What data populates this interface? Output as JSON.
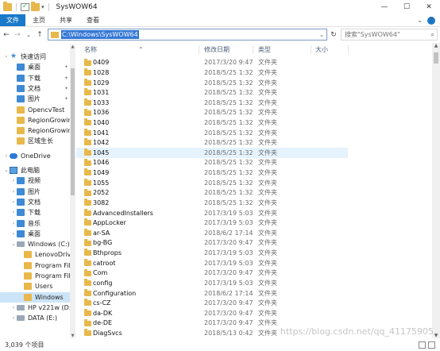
{
  "window": {
    "title": "SysWOW64",
    "minimize": "—",
    "maximize": "☐",
    "close": "✕"
  },
  "ribbon": {
    "tabs": [
      "文件",
      "主页",
      "共享",
      "查看"
    ],
    "expand": "⌄",
    "help": "?"
  },
  "nav": {
    "back": "←",
    "forward": "→",
    "recent": "⌄",
    "up": "↑",
    "address": "C:\\Windows\\SysWOW64",
    "refresh": "↻",
    "search_placeholder": "搜索\"SysWOW64\""
  },
  "columns": {
    "name": "名称",
    "date": "修改日期",
    "type": "类型",
    "size": "大小"
  },
  "sidebar": [
    {
      "label": "快速访问",
      "icon": "star-icon",
      "arrow": "›",
      "indent": 0,
      "pin": false
    },
    {
      "label": "桌面",
      "icon": "desktop-folder-icon",
      "indent": 1,
      "pin": true
    },
    {
      "label": "下载",
      "icon": "download-folder-icon",
      "indent": 1,
      "pin": true
    },
    {
      "label": "文档",
      "icon": "documents-folder-icon",
      "indent": 1,
      "pin": true
    },
    {
      "label": "图片",
      "icon": "pictures-folder-icon",
      "indent": 1,
      "pin": true
    },
    {
      "label": "OpencvTest",
      "icon": "folder-icon",
      "indent": 1,
      "pin": false
    },
    {
      "label": "RegionGrowing",
      "icon": "folder-icon",
      "indent": 1,
      "pin": false
    },
    {
      "label": "RegionGrowing",
      "icon": "folder-icon",
      "indent": 1,
      "pin": false
    },
    {
      "label": "区域生长",
      "icon": "folder-icon",
      "indent": 1,
      "pin": false
    },
    {
      "label": "OneDrive",
      "icon": "onedrive-icon",
      "arrow": "›",
      "indent": 0,
      "pin": false
    },
    {
      "label": "此电脑",
      "icon": "this-pc-icon",
      "arrow": "⌄",
      "indent": 0,
      "pin": false
    },
    {
      "label": "视频",
      "icon": "videos-folder-icon",
      "arrow": "›",
      "indent": 1,
      "pin": false
    },
    {
      "label": "图片",
      "icon": "pictures-folder-icon",
      "arrow": "›",
      "indent": 1,
      "pin": false
    },
    {
      "label": "文档",
      "icon": "documents-folder-icon",
      "arrow": "›",
      "indent": 1,
      "pin": false
    },
    {
      "label": "下载",
      "icon": "download-folder-icon",
      "arrow": "›",
      "indent": 1,
      "pin": false
    },
    {
      "label": "音乐",
      "icon": "music-folder-icon",
      "arrow": "›",
      "indent": 1,
      "pin": false
    },
    {
      "label": "桌面",
      "icon": "desktop-folder-icon",
      "arrow": "›",
      "indent": 1,
      "pin": false
    },
    {
      "label": "Windows (C:)",
      "icon": "drive-icon",
      "arrow": "⌄",
      "indent": 1,
      "pin": false
    },
    {
      "label": "LenovoDriver",
      "icon": "folder-icon",
      "indent": 2,
      "pin": false
    },
    {
      "label": "Program Files",
      "icon": "folder-icon",
      "indent": 2,
      "pin": false
    },
    {
      "label": "Program Files",
      "icon": "folder-icon",
      "indent": 2,
      "pin": false
    },
    {
      "label": "Users",
      "icon": "folder-icon",
      "indent": 2,
      "pin": false
    },
    {
      "label": "Windows",
      "icon": "folder-icon",
      "indent": 2,
      "pin": false,
      "selected": true
    },
    {
      "label": "HP v221w (D:)",
      "icon": "drive-icon",
      "arrow": "›",
      "indent": 1,
      "pin": false
    },
    {
      "label": "DATA (E:)",
      "icon": "drive-icon",
      "arrow": "›",
      "indent": 1,
      "pin": false
    }
  ],
  "files": [
    {
      "name": "0409",
      "date": "2017/3/20 9:47",
      "type": "文件夹"
    },
    {
      "name": "1028",
      "date": "2018/5/25 1:32",
      "type": "文件夹"
    },
    {
      "name": "1029",
      "date": "2018/5/25 1:32",
      "type": "文件夹"
    },
    {
      "name": "1031",
      "date": "2018/5/25 1:32",
      "type": "文件夹"
    },
    {
      "name": "1033",
      "date": "2018/5/25 1:32",
      "type": "文件夹"
    },
    {
      "name": "1036",
      "date": "2018/5/25 1:32",
      "type": "文件夹"
    },
    {
      "name": "1040",
      "date": "2018/5/25 1:32",
      "type": "文件夹"
    },
    {
      "name": "1041",
      "date": "2018/5/25 1:32",
      "type": "文件夹"
    },
    {
      "name": "1042",
      "date": "2018/5/25 1:32",
      "type": "文件夹"
    },
    {
      "name": "1045",
      "date": "2018/5/25 1:32",
      "type": "文件夹",
      "hover": true
    },
    {
      "name": "1046",
      "date": "2018/5/25 1:32",
      "type": "文件夹"
    },
    {
      "name": "1049",
      "date": "2018/5/25 1:32",
      "type": "文件夹"
    },
    {
      "name": "1055",
      "date": "2018/5/25 1:32",
      "type": "文件夹"
    },
    {
      "name": "2052",
      "date": "2018/5/25 1:32",
      "type": "文件夹"
    },
    {
      "name": "3082",
      "date": "2018/5/25 1:32",
      "type": "文件夹"
    },
    {
      "name": "AdvancedInstallers",
      "date": "2017/3/19 5:03",
      "type": "文件夹"
    },
    {
      "name": "AppLocker",
      "date": "2017/3/19 5:03",
      "type": "文件夹"
    },
    {
      "name": "ar-SA",
      "date": "2018/6/2 17:14",
      "type": "文件夹"
    },
    {
      "name": "bg-BG",
      "date": "2017/3/20 9:47",
      "type": "文件夹"
    },
    {
      "name": "Bthprops",
      "date": "2017/3/19 5:03",
      "type": "文件夹"
    },
    {
      "name": "catroot",
      "date": "2017/3/19 5:03",
      "type": "文件夹"
    },
    {
      "name": "Com",
      "date": "2017/3/20 9:47",
      "type": "文件夹"
    },
    {
      "name": "config",
      "date": "2017/3/19 5:03",
      "type": "文件夹"
    },
    {
      "name": "Configuration",
      "date": "2018/6/2 17:14",
      "type": "文件夹"
    },
    {
      "name": "cs-CZ",
      "date": "2017/3/20 9:47",
      "type": "文件夹"
    },
    {
      "name": "da-DK",
      "date": "2017/3/20 9:47",
      "type": "文件夹"
    },
    {
      "name": "de-DE",
      "date": "2017/3/20 9:47",
      "type": "文件夹"
    },
    {
      "name": "DiagSvcs",
      "date": "2018/5/13 0:42",
      "type": "文件夹"
    }
  ],
  "status": {
    "count": "3,039 个项目"
  },
  "watermark": "https://blog.csdn.net/qq_41175905",
  "colors": {
    "accent": "#1979ca",
    "folder": "#e8b84a",
    "selection": "#cce4f7",
    "hover": "#e5f3ff"
  }
}
